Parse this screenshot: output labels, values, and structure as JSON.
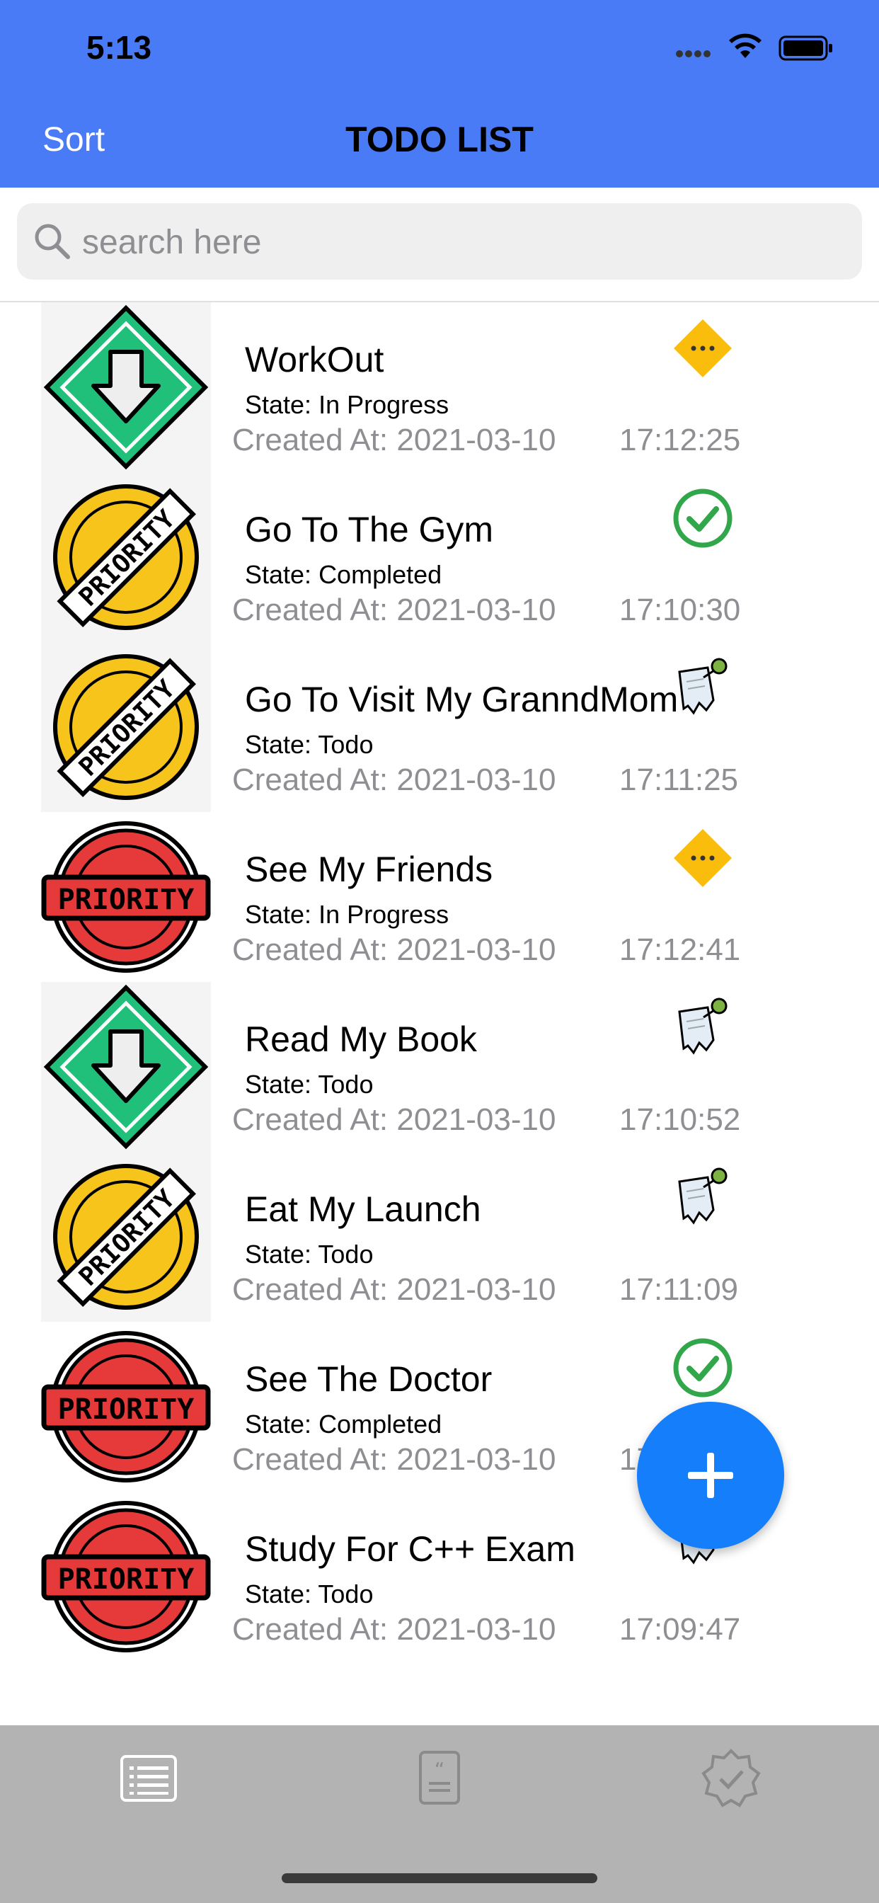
{
  "status_bar": {
    "time": "5:13"
  },
  "nav": {
    "sort_label": "Sort",
    "title": "TODO LIST"
  },
  "search": {
    "placeholder": "search here",
    "value": ""
  },
  "todos": [
    {
      "title": "WorkOut",
      "state": "State: In Progress",
      "created": "Created At: 2021-03-10",
      "time": "17:12:25",
      "priority_icon": "green-down-arrow-icon",
      "status_icon": "in-progress-icon"
    },
    {
      "title": "Go To The Gym",
      "state": "State: Completed",
      "created": "Created At: 2021-03-10",
      "time": "17:10:30",
      "priority_icon": "yellow-priority-badge-icon",
      "status_icon": "completed-icon"
    },
    {
      "title": "Go To Visit My GranndMom",
      "state": "State: Todo",
      "created": "Created At: 2021-03-10",
      "time": "17:11:25",
      "priority_icon": "yellow-priority-badge-icon",
      "status_icon": "todo-note-icon"
    },
    {
      "title": "See My Friends",
      "state": "State: In Progress",
      "created": "Created At: 2021-03-10",
      "time": "17:12:41",
      "priority_icon": "red-priority-badge-icon",
      "status_icon": "in-progress-icon"
    },
    {
      "title": "Read My Book",
      "state": "State: Todo",
      "created": "Created At: 2021-03-10",
      "time": "17:10:52",
      "priority_icon": "green-down-arrow-icon",
      "status_icon": "todo-note-icon"
    },
    {
      "title": "Eat My Launch",
      "state": "State: Todo",
      "created": "Created At: 2021-03-10",
      "time": "17:11:09",
      "priority_icon": "yellow-priority-badge-icon",
      "status_icon": "todo-note-icon"
    },
    {
      "title": "See The Doctor",
      "state": "State: Completed",
      "created": "Created At: 2021-03-10",
      "time": "17:10:15",
      "priority_icon": "red-priority-badge-icon",
      "status_icon": "completed-icon"
    },
    {
      "title": "Study For C++ Exam",
      "state": "State: Todo",
      "created": "Created At: 2021-03-10",
      "time": "17:09:47",
      "priority_icon": "red-priority-badge-icon",
      "status_icon": "todo-note-icon"
    }
  ],
  "badge_text": "PRIORITY",
  "tabs": [
    {
      "name": "list-tab",
      "icon": "list-icon",
      "selected": true
    },
    {
      "name": "quotes-tab",
      "icon": "quote-document-icon",
      "selected": false
    },
    {
      "name": "completed-tab",
      "icon": "verified-badge-icon",
      "selected": false
    }
  ],
  "colors": {
    "header": "#4a7bf7",
    "fab": "#147efb",
    "tabbar": "#b3b3b3",
    "green_priority": "#21c07a",
    "yellow_priority": "#f7c41c",
    "red_priority": "#e63a3a",
    "in_progress": "#fbbd0c",
    "completed": "#31a64a"
  }
}
